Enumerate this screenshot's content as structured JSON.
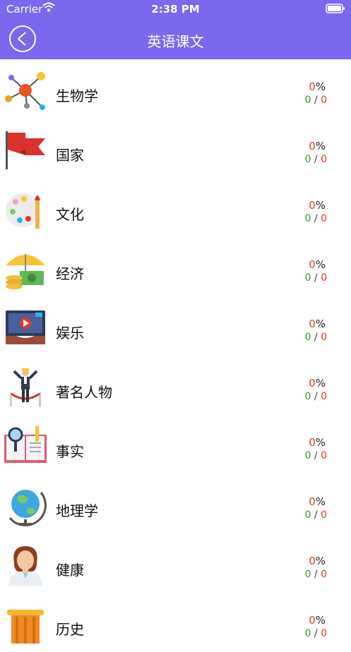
{
  "status_bar": {
    "carrier": "Carrier",
    "time": "2:38 PM"
  },
  "nav": {
    "title": "英语课文"
  },
  "topics": [
    {
      "label": "生物学",
      "icon": "molecule-icon",
      "percent": "0",
      "correct": "0",
      "wrong": "0"
    },
    {
      "label": "国家",
      "icon": "flag-icon",
      "percent": "0",
      "correct": "0",
      "wrong": "0"
    },
    {
      "label": "文化",
      "icon": "palette-icon",
      "percent": "0",
      "correct": "0",
      "wrong": "0"
    },
    {
      "label": "经济",
      "icon": "money-umbrella-icon",
      "percent": "0",
      "correct": "0",
      "wrong": "0"
    },
    {
      "label": "娱乐",
      "icon": "tv-play-icon",
      "percent": "0",
      "correct": "0",
      "wrong": "0"
    },
    {
      "label": "著名人物",
      "icon": "celebrity-icon",
      "percent": "0",
      "correct": "0",
      "wrong": "0"
    },
    {
      "label": "事实",
      "icon": "book-magnifier-icon",
      "percent": "0",
      "correct": "0",
      "wrong": "0"
    },
    {
      "label": "地理学",
      "icon": "globe-icon",
      "percent": "0",
      "correct": "0",
      "wrong": "0"
    },
    {
      "label": "健康",
      "icon": "doctor-icon",
      "percent": "0",
      "correct": "0",
      "wrong": "0"
    },
    {
      "label": "历史",
      "icon": "column-icon",
      "percent": "0",
      "correct": "0",
      "wrong": "0"
    }
  ]
}
